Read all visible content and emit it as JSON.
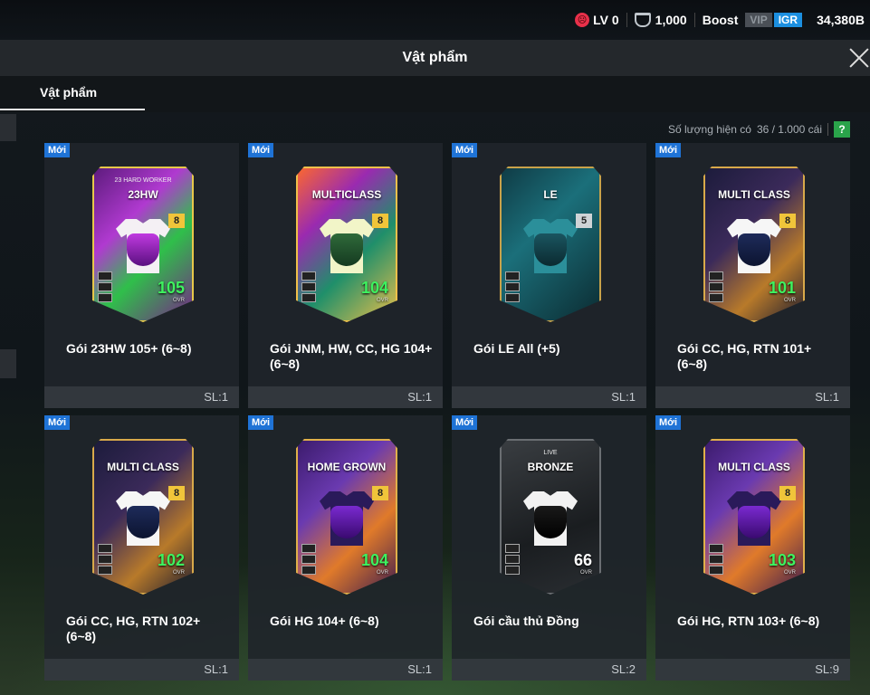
{
  "topbar": {
    "level": "LV 0",
    "coins": "1,000",
    "boost": "Boost",
    "vip": "VIP",
    "igr": "IGR",
    "bp": "34,380B"
  },
  "header": {
    "title": "Vật phẩm"
  },
  "tabs": [
    {
      "label": "Vật phẩm",
      "active": true
    }
  ],
  "inventory": {
    "label": "Số lượng hiện có",
    "value": "36 / 1.000 cái",
    "help": "?"
  },
  "new_tag": "Mới",
  "items": [
    {
      "name": "Gói 23HW 105+ (6~8)",
      "qty": "SL:1",
      "pack_label": "23HW",
      "pack_sublabel": "23 HARD WORKER",
      "grade": "8",
      "ovr": "105",
      "ovr_label": "OVR",
      "theme": "purple-green"
    },
    {
      "name": "Gói JNM, HW, CC, HG 104+ (6~8)",
      "qty": "SL:1",
      "pack_label": "MULTICLASS",
      "pack_sublabel": "",
      "grade": "8",
      "ovr": "104",
      "ovr_label": "OVR",
      "theme": "multicolor"
    },
    {
      "name": "Gói LE All (+5)",
      "qty": "SL:1",
      "pack_label": "LE",
      "pack_sublabel": "",
      "grade": "5",
      "ovr": "",
      "ovr_label": "",
      "theme": "teal"
    },
    {
      "name": "Gói CC, HG, RTN 101+ (6~8)",
      "qty": "SL:1",
      "pack_label": "MULTI CLASS",
      "pack_sublabel": "",
      "grade": "8",
      "ovr": "101",
      "ovr_label": "OVR",
      "theme": "navy-gold"
    },
    {
      "name": "Gói CC, HG, RTN 102+ (6~8)",
      "qty": "SL:1",
      "pack_label": "MULTI CLASS",
      "pack_sublabel": "",
      "grade": "8",
      "ovr": "102",
      "ovr_label": "OVR",
      "theme": "navy-gold"
    },
    {
      "name": "Gói HG 104+ (6~8)",
      "qty": "SL:1",
      "pack_label": "HOME GROWN",
      "pack_sublabel": "",
      "grade": "8",
      "ovr": "104",
      "ovr_label": "OVR",
      "theme": "purple-orange"
    },
    {
      "name": "Gói cầu thủ Đồng",
      "qty": "SL:2",
      "pack_label": "BRONZE",
      "pack_sublabel": "LIVE",
      "grade": "",
      "ovr": "66",
      "ovr_label": "OVR",
      "theme": "dark"
    },
    {
      "name": "Gói HG, RTN 103+ (6~8)",
      "qty": "SL:9",
      "pack_label": "MULTI CLASS",
      "pack_sublabel": "",
      "grade": "8",
      "ovr": "103",
      "ovr_label": "OVR",
      "theme": "purple-orange"
    }
  ],
  "colors": {
    "new_badge": "#1f73d6",
    "ovr_green": "#3ef25f",
    "help_green": "#2aa34a",
    "igr_blue": "#1c8fe0"
  }
}
